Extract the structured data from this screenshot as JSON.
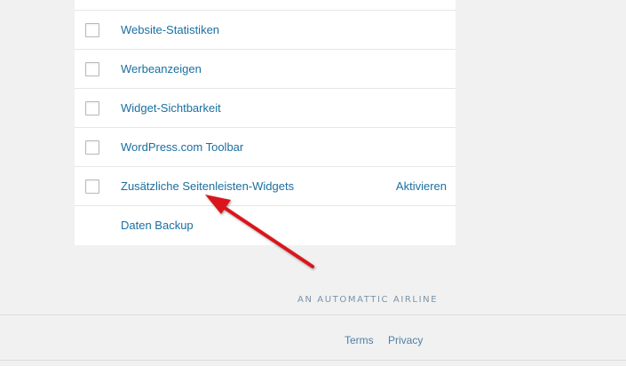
{
  "modules": [
    {
      "name": "Website-Statistiken",
      "action": ""
    },
    {
      "name": "Werbeanzeigen",
      "action": ""
    },
    {
      "name": "Widget-Sichtbarkeit",
      "action": ""
    },
    {
      "name": "WordPress.com Toolbar",
      "action": ""
    },
    {
      "name": "Zusätzliche Seitenleisten-Widgets",
      "action": "Aktivieren"
    },
    {
      "name": "Daten Backup",
      "action": ""
    }
  ],
  "footer": {
    "airline_text": "AN AUTOMATTIC AIRLINE",
    "terms": "Terms",
    "privacy": "Privacy"
  },
  "colors": {
    "link": "#1a6fa0",
    "arrow": "#d9161c",
    "background": "#f1f1f1"
  }
}
